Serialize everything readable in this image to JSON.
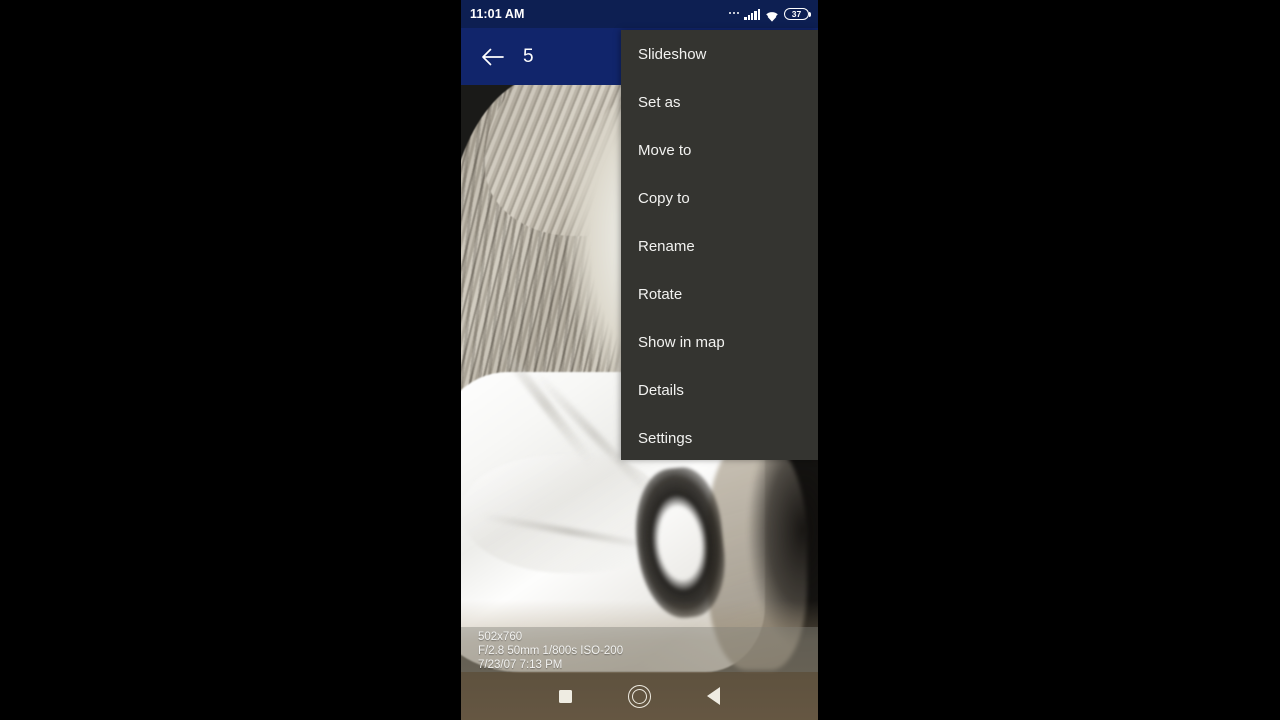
{
  "status_bar": {
    "time": "11:01 AM",
    "battery_level": "37",
    "icons": [
      "more-dots-icon",
      "cellular-signal-icon",
      "wifi-icon",
      "battery-icon"
    ],
    "background_color": "#0d1f52"
  },
  "app_bar": {
    "back_icon": "arrow-left-icon",
    "title": "5",
    "background_color": "#11256b"
  },
  "menu": {
    "background_color": "#343430",
    "items": [
      {
        "label": "Slideshow"
      },
      {
        "label": "Set as"
      },
      {
        "label": "Move to"
      },
      {
        "label": "Copy to"
      },
      {
        "label": "Rename"
      },
      {
        "label": "Rotate"
      },
      {
        "label": "Show in map"
      },
      {
        "label": "Details"
      },
      {
        "label": "Settings"
      }
    ]
  },
  "photo": {
    "description": "black-and-white portrait of a woman with light blonde hair wearing a white blouse"
  },
  "exif": {
    "dimensions": "502x760",
    "capture_settings": "F/2.8 50mm 1/800s ISO-200",
    "datetime": "7/23/07 7:13 PM"
  },
  "nav_bar": {
    "recents_icon": "square-icon",
    "home_icon": "circle-icon",
    "back_icon": "triangle-left-icon"
  }
}
